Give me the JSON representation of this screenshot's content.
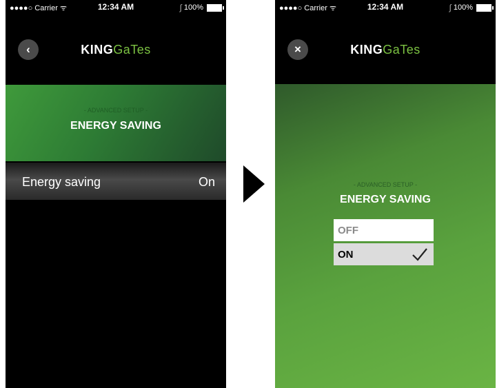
{
  "left": {
    "status": {
      "carrier": "●●●●○ Carrier ᯤ",
      "time": "12:34 AM",
      "battery": "100%"
    },
    "logo": {
      "brand_bold": "KING",
      "brand_light": "GaTes"
    },
    "header": {
      "subtitle": "- ADVANCED SETUP -",
      "title": "ENERGY SAVING"
    },
    "row": {
      "label": "Energy saving",
      "value": "On"
    }
  },
  "right": {
    "status": {
      "carrier": "●●●●○ Carrier ᯤ",
      "time": "12:34 AM",
      "battery": "100%"
    },
    "logo": {
      "brand_bold": "KING",
      "brand_light": "GaTes"
    },
    "header": {
      "subtitle": "- ADVANCED SETUP -",
      "title": "ENERGY SAVING"
    },
    "options": [
      {
        "label": "OFF",
        "selected": false
      },
      {
        "label": "ON",
        "selected": true
      }
    ]
  },
  "colors": {
    "accent_green": "#7cc242",
    "background": "#000000"
  }
}
